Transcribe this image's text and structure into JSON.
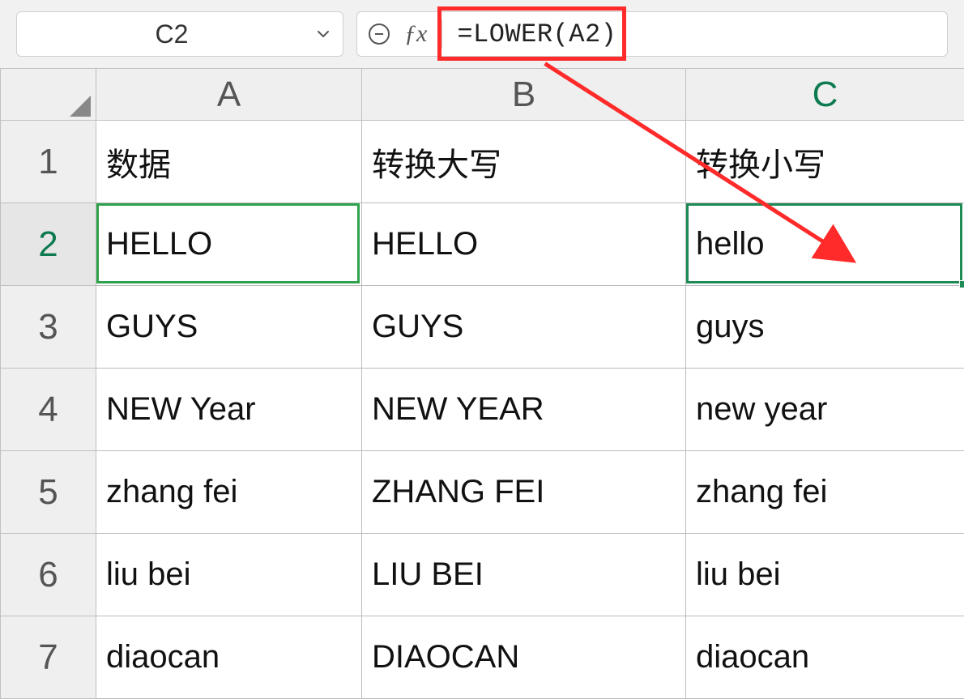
{
  "namebox": {
    "ref": "C2"
  },
  "formula_bar": {
    "formula": "=LOWER(A2)"
  },
  "columns": [
    "A",
    "B",
    "C"
  ],
  "active_column": "C",
  "active_row": 2,
  "rows": [
    {
      "n": 1,
      "a": "数据",
      "b": "转换大写",
      "c": "转换小写"
    },
    {
      "n": 2,
      "a": "HELLO",
      "b": "HELLO",
      "c": "hello"
    },
    {
      "n": 3,
      "a": "GUYS",
      "b": "GUYS",
      "c": "guys"
    },
    {
      "n": 4,
      "a": "NEW Year",
      "b": "NEW YEAR",
      "c": "new year"
    },
    {
      "n": 5,
      "a": "zhang fei",
      "b": "ZHANG FEI",
      "c": "zhang fei"
    },
    {
      "n": 6,
      "a": "liu bei",
      "b": "LIU BEI",
      "c": "liu bei"
    },
    {
      "n": 7,
      "a": "diaocan",
      "b": "DIAOCAN",
      "c": "diaocan"
    }
  ],
  "annotation": {
    "highlight": "formula-bar-formula",
    "arrow_from": "formula-bar",
    "arrow_to": "cell-C2"
  }
}
